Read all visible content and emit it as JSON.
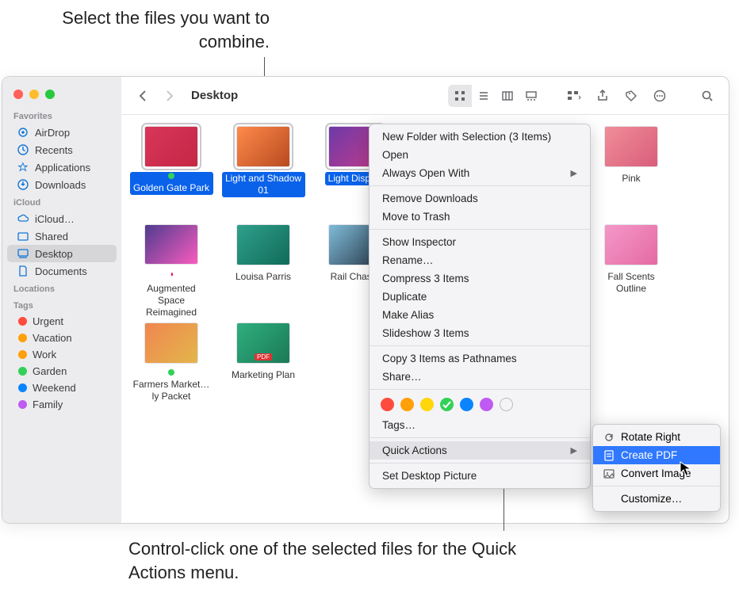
{
  "annotations": {
    "top": "Select the files you want to combine.",
    "bottom": "Control-click one of the selected files for the Quick Actions menu."
  },
  "window": {
    "title": "Desktop"
  },
  "sidebar": {
    "sections": [
      {
        "title": "Favorites",
        "items": [
          {
            "label": "AirDrop",
            "icon": "airdrop-icon"
          },
          {
            "label": "Recents",
            "icon": "clock-icon"
          },
          {
            "label": "Applications",
            "icon": "apps-icon"
          },
          {
            "label": "Downloads",
            "icon": "downloads-icon"
          }
        ]
      },
      {
        "title": "iCloud",
        "items": [
          {
            "label": "iCloud…",
            "icon": "cloud-icon"
          },
          {
            "label": "Shared",
            "icon": "shared-icon"
          },
          {
            "label": "Desktop",
            "icon": "desktop-icon",
            "active": true
          },
          {
            "label": "Documents",
            "icon": "documents-icon"
          }
        ]
      },
      {
        "title": "Locations",
        "items": []
      },
      {
        "title": "Tags",
        "items": [
          {
            "label": "Urgent",
            "color": "#ff4b3e"
          },
          {
            "label": "Vacation",
            "color": "#ff9f0a"
          },
          {
            "label": "Work",
            "color": "#ff9f0a"
          },
          {
            "label": "Garden",
            "color": "#32d158"
          },
          {
            "label": "Weekend",
            "color": "#0a84ff"
          },
          {
            "label": "Family",
            "color": "#bf5af2"
          }
        ]
      }
    ]
  },
  "files": [
    {
      "label": "Golden Gate Park",
      "thumb": "#d8365a|#c52744",
      "selected": true,
      "status": "#32d158"
    },
    {
      "label": "Light and Shadow 01",
      "thumb": "#ff8a4c|#b84a1f",
      "selected": true
    },
    {
      "label": "Light Display",
      "thumb": "#6d3aa8|#c23b8a",
      "selected": true
    },
    {
      "label": "",
      "hidden_behind_menu": true
    },
    {
      "label": "",
      "hidden_behind_menu": true
    },
    {
      "label": "Pink",
      "thumb": "#f08e9a|#d95d7a"
    },
    {
      "label": "Augmented Space Reimagined",
      "thumb": "#4f3b8f|#f95cbf",
      "badge": true
    },
    {
      "label": "Louisa Parris",
      "thumb": "#2fa08c|#106b59"
    },
    {
      "label": "Rail Chaser",
      "thumb": "#7fbbd9|#2a3c4c"
    },
    {
      "label": "",
      "hidden_behind_menu": true
    },
    {
      "label": "",
      "hidden_behind_menu": true
    },
    {
      "label": "Fall Scents Outline",
      "thumb": "#f598c9|#e46aa3"
    },
    {
      "label": "Farmers Market…ly Packet",
      "thumb": "#f08650|#e3b64b",
      "status": "#32d158"
    },
    {
      "label": "Marketing Plan",
      "thumb": "#2fae7e|#1b7a57",
      "pdf": true
    }
  ],
  "context_menu": {
    "items": [
      {
        "label": "New Folder with Selection (3 Items)"
      },
      {
        "label": "Open"
      },
      {
        "label": "Always Open With",
        "arrow": true
      },
      {
        "sep": true
      },
      {
        "label": "Remove Downloads"
      },
      {
        "label": "Move to Trash"
      },
      {
        "sep": true
      },
      {
        "label": "Show Inspector"
      },
      {
        "label": "Rename…"
      },
      {
        "label": "Compress 3 Items"
      },
      {
        "label": "Duplicate"
      },
      {
        "label": "Make Alias"
      },
      {
        "label": "Slideshow 3 Items"
      },
      {
        "sep": true
      },
      {
        "label": "Copy 3 Items as Pathnames"
      },
      {
        "label": "Share…"
      },
      {
        "sep": true
      },
      {
        "tags": true
      },
      {
        "label": "Tags…"
      },
      {
        "sep": true
      },
      {
        "label": "Quick Actions",
        "arrow": true,
        "highlight": true
      },
      {
        "sep": true
      },
      {
        "label": "Set Desktop Picture"
      }
    ],
    "tag_colors": [
      "#ff4b3e",
      "#ff9f0a",
      "#ffd60a",
      "#32d158",
      "#0a84ff",
      "#bf5af2",
      "#bcbcc0"
    ]
  },
  "submenu": {
    "items": [
      {
        "label": "Rotate Right",
        "icon": "rotate-icon"
      },
      {
        "label": "Create PDF",
        "icon": "pdf-icon",
        "highlight": true
      },
      {
        "label": "Convert Image",
        "icon": "image-icon"
      },
      {
        "sep": true
      },
      {
        "label": "Customize…"
      }
    ]
  }
}
